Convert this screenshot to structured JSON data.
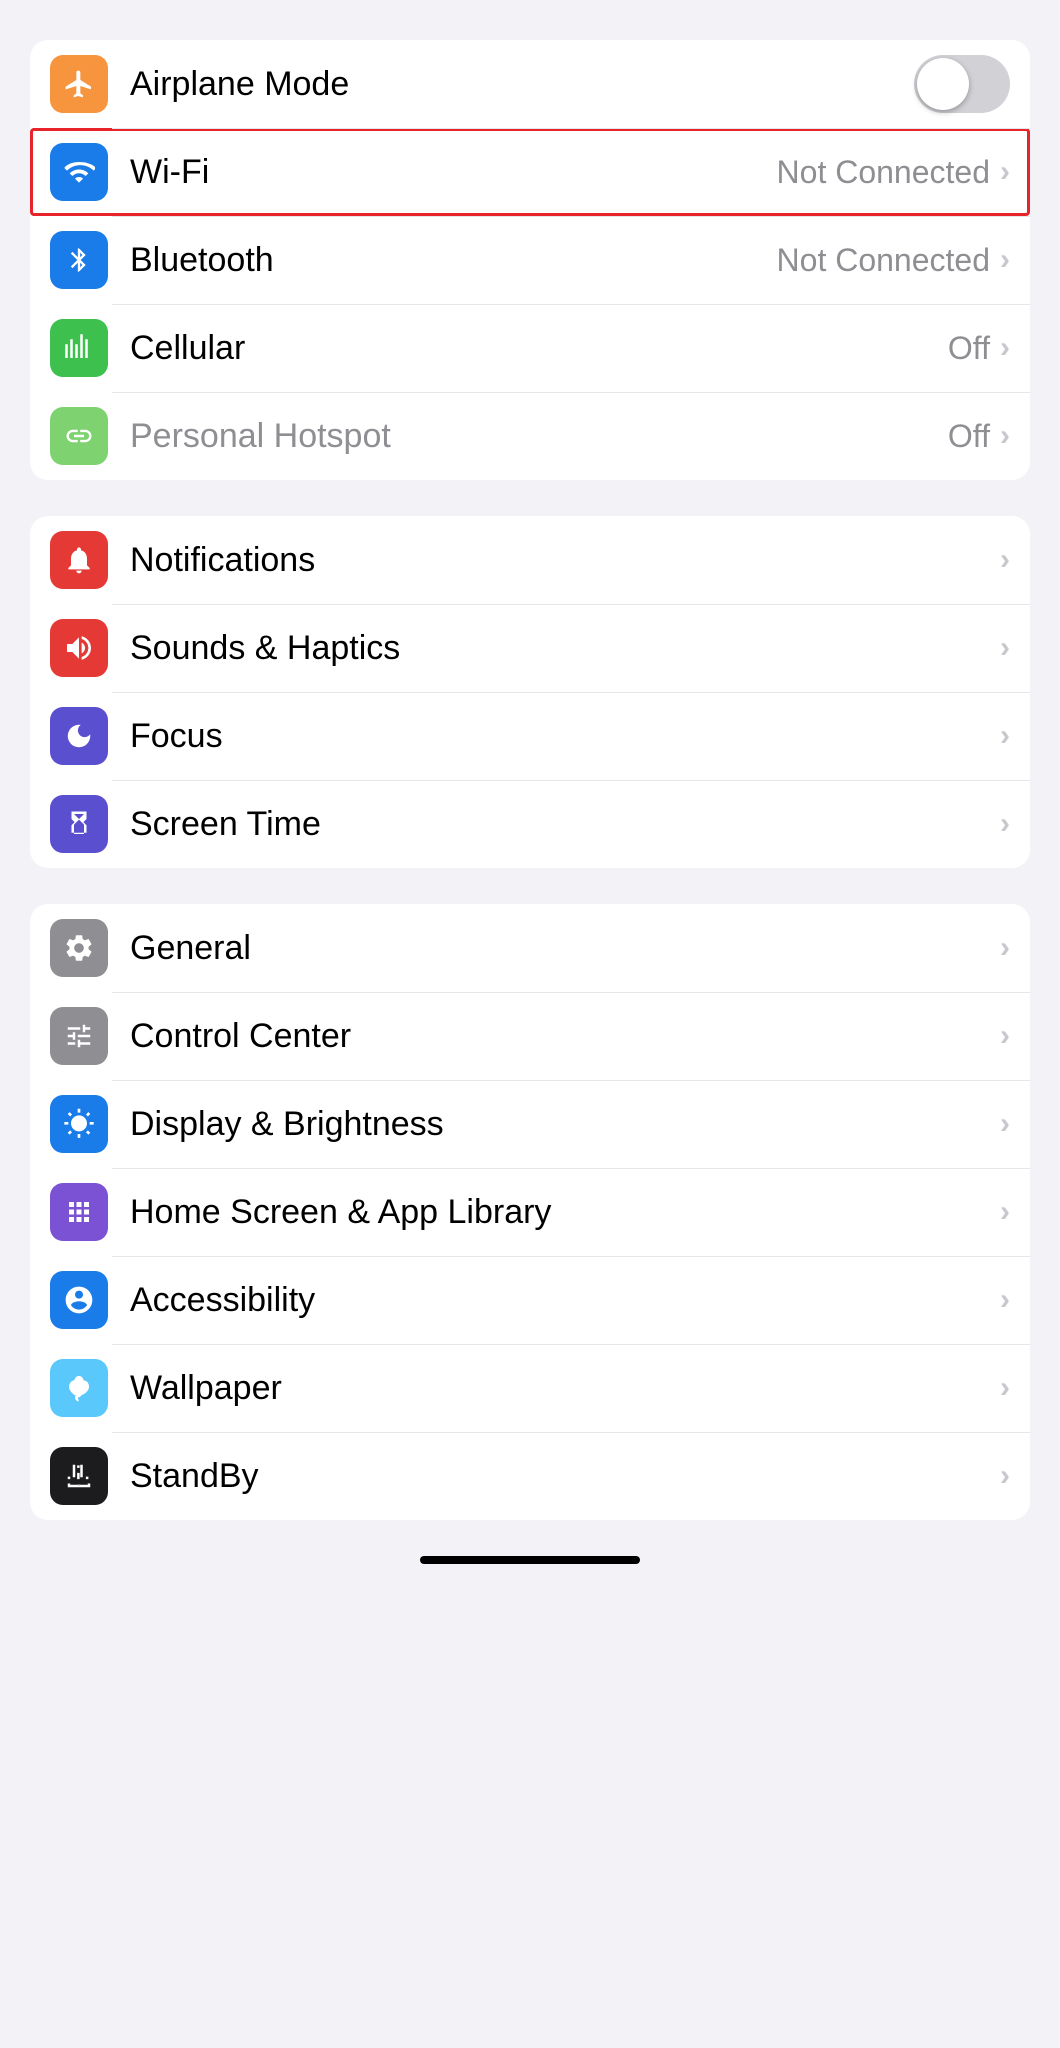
{
  "groups": [
    {
      "id": "connectivity",
      "rows": [
        {
          "id": "airplane-mode",
          "label": "Airplane Mode",
          "icon": "airplane",
          "iconBg": "bg-orange",
          "type": "toggle",
          "toggleOn": false,
          "highlighted": false
        },
        {
          "id": "wifi",
          "label": "Wi-Fi",
          "icon": "wifi",
          "iconBg": "bg-blue",
          "type": "chevron",
          "value": "Not Connected",
          "highlighted": true
        },
        {
          "id": "bluetooth",
          "label": "Bluetooth",
          "icon": "bluetooth",
          "iconBg": "bg-bluetooth",
          "type": "chevron",
          "value": "Not Connected",
          "highlighted": false
        },
        {
          "id": "cellular",
          "label": "Cellular",
          "icon": "cellular",
          "iconBg": "bg-green-cellular",
          "type": "chevron",
          "value": "Off",
          "highlighted": false
        },
        {
          "id": "hotspot",
          "label": "Personal Hotspot",
          "icon": "hotspot",
          "iconBg": "bg-green-hotspot",
          "type": "chevron",
          "value": "Off",
          "labelDimmed": true,
          "highlighted": false
        }
      ]
    },
    {
      "id": "notifications",
      "rows": [
        {
          "id": "notifications",
          "label": "Notifications",
          "icon": "bell",
          "iconBg": "bg-red-notif",
          "type": "chevron",
          "highlighted": false
        },
        {
          "id": "sounds",
          "label": "Sounds & Haptics",
          "icon": "sounds",
          "iconBg": "bg-red-sounds",
          "type": "chevron",
          "highlighted": false
        },
        {
          "id": "focus",
          "label": "Focus",
          "icon": "moon",
          "iconBg": "bg-purple-focus",
          "type": "chevron",
          "highlighted": false
        },
        {
          "id": "screentime",
          "label": "Screen Time",
          "icon": "hourglass",
          "iconBg": "bg-purple-screen",
          "type": "chevron",
          "highlighted": false
        }
      ]
    },
    {
      "id": "display",
      "rows": [
        {
          "id": "general",
          "label": "General",
          "icon": "gear",
          "iconBg": "bg-gray-general",
          "type": "chevron",
          "highlighted": false
        },
        {
          "id": "controlcenter",
          "label": "Control Center",
          "icon": "sliders",
          "iconBg": "bg-gray-control",
          "type": "chevron",
          "highlighted": false
        },
        {
          "id": "displaybrightness",
          "label": "Display & Brightness",
          "icon": "sun",
          "iconBg": "bg-blue-display",
          "type": "chevron",
          "highlighted": false
        },
        {
          "id": "homescreen",
          "label": "Home Screen & App Library",
          "icon": "grid",
          "iconBg": "bg-purple-home",
          "type": "chevron",
          "highlighted": false
        },
        {
          "id": "accessibility",
          "label": "Accessibility",
          "icon": "person-circle",
          "iconBg": "bg-blue-access",
          "type": "chevron",
          "highlighted": false
        },
        {
          "id": "wallpaper",
          "label": "Wallpaper",
          "icon": "flower",
          "iconBg": "bg-teal-wallpaper",
          "type": "chevron",
          "highlighted": false
        },
        {
          "id": "standby",
          "label": "StandBy",
          "icon": "standby",
          "iconBg": "bg-black-standby",
          "type": "chevron",
          "highlighted": false
        }
      ]
    }
  ],
  "chevron_char": "›",
  "bottom_bar": true
}
